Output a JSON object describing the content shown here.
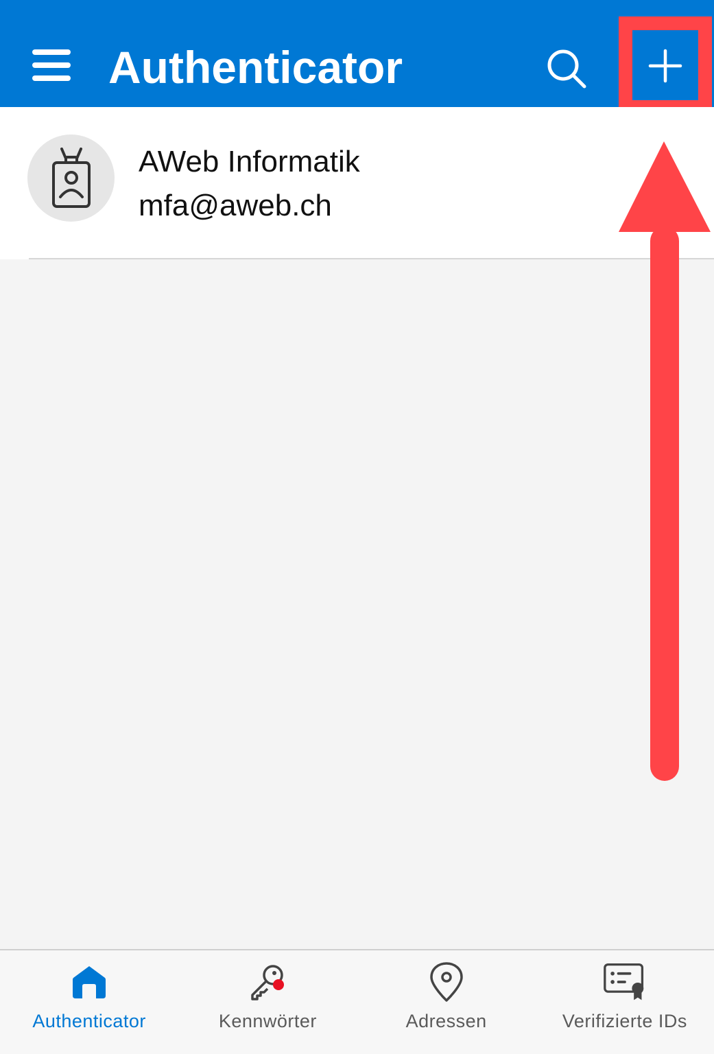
{
  "header": {
    "title": "Authenticator",
    "menu_icon": "hamburger-menu-icon",
    "search_icon": "search-icon",
    "add_icon": "plus-icon",
    "bg_color": "#0078d4"
  },
  "accounts": [
    {
      "name": "AWeb Informatik",
      "email": "mfa@aweb.ch",
      "icon": "id-badge-icon"
    }
  ],
  "annotation": {
    "color": "#ff4448",
    "highlight_target": "add-button",
    "arrow_direction": "up"
  },
  "bottom_nav": {
    "items": [
      {
        "label": "Authenticator",
        "icon": "home-icon",
        "active": true
      },
      {
        "label": "Kennwörter",
        "icon": "key-icon",
        "active": false,
        "badge_color": "#e81123"
      },
      {
        "label": "Adressen",
        "icon": "location-pin-icon",
        "active": false
      },
      {
        "label": "Verifizierte IDs",
        "icon": "verified-id-card-icon",
        "active": false
      }
    ],
    "active_color": "#0078d4",
    "inactive_color": "#5a5a5a"
  }
}
